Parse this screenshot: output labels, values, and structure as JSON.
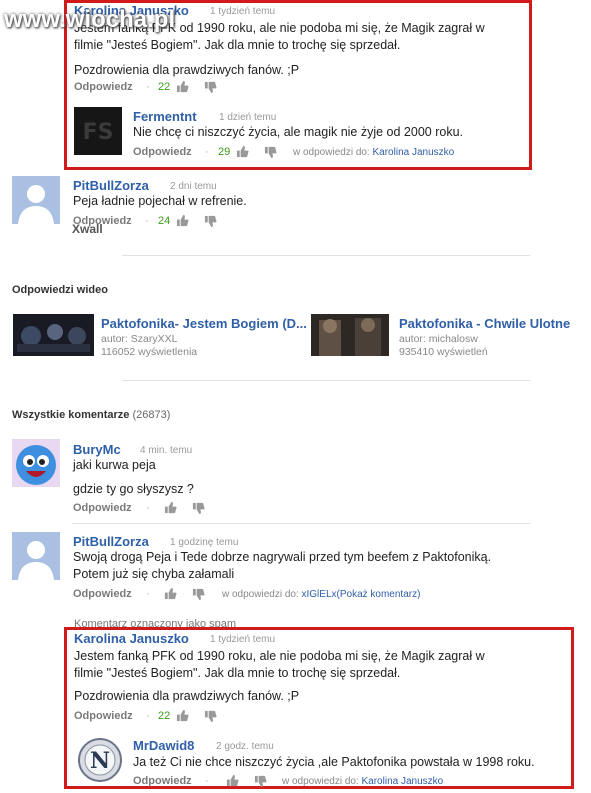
{
  "watermark": "www.wiocha.pl",
  "top_comment": {
    "author": "Karolina Januszko",
    "time": "1 tydzień temu",
    "line1": "Jestem fanką PFK od 1990 roku, ale nie podoba mi się, że Magik zagrał w",
    "line2": "filmie \"Jesteś Bogiem\". Jak dla mnie to trochę się sprzedał.",
    "line3": "Pozdrowienia dla prawdziwych fanów. ;P",
    "reply_label": "Odpowiedz",
    "likes": "22"
  },
  "top_reply": {
    "author": "Fermentnt",
    "time": "1 dzień temu",
    "text": "Nie chcę ci niszczyć życia, ale magik nie żyje od 2000 roku.",
    "reply_label": "Odpowiedz",
    "likes": "29",
    "in_reply_prefix": "w odpowiedzi do:",
    "in_reply_user": "Karolina Januszko"
  },
  "pitbull1": {
    "author": "PitBullZorza",
    "time": "2 dni temu",
    "text": "Peja ładnie pojechał w refrenie.",
    "reply_label": "Odpowiedz",
    "likes": "24",
    "overlay": "Xwall"
  },
  "video_section": {
    "title": "Odpowiedzi wideo",
    "videos": [
      {
        "title": "Paktofonika- Jestem Bogiem (D...",
        "author": "autor: SzaryXXL",
        "views": "116052 wyświetlenia"
      },
      {
        "title": "Paktofonika - Chwile Ulotne",
        "author": "autor: michalosw",
        "views": "935410 wyświetleń"
      }
    ]
  },
  "all_comments": {
    "title": "Wszystkie komentarze",
    "count": "(26873)"
  },
  "burymc": {
    "author": "BuryMc",
    "time": "4 min. temu",
    "line1": "jaki kurwa peja",
    "line2": "gdzie ty go słyszysz ?",
    "reply_label": "Odpowiedz"
  },
  "pitbull2": {
    "author": "PitBullZorza",
    "time": "1 godzinę temu",
    "line1": "Swoją drogą Peja i Tede dobrze nagrywali przed tym beefem z Paktofoniką.",
    "line2": "Potem już się chyba załamali",
    "reply_label": "Odpowiedz",
    "in_reply_prefix": "w odpowiedzi do:",
    "in_reply_user": "xIGlELx",
    "show_comment": "(Pokaż komentarz)"
  },
  "flagged": "Komentarz oznaczony jako spam",
  "bottom_comment": {
    "author": "Karolina Januszko",
    "time": "1 tydzień temu",
    "line1": "Jestem fanką PFK od 1990 roku, ale nie podoba mi się, że Magik zagrał w",
    "line2": "filmie \"Jesteś Bogiem\". Jak dla mnie to trochę się sprzedał.",
    "line3": "Pozdrowienia dla prawdziwych fanów. ;P",
    "reply_label": "Odpowiedz",
    "likes": "22"
  },
  "bottom_reply": {
    "author": "MrDawid8",
    "time": "2 godz. temu",
    "text": "Ja też Ci nie chce niszczyć życia ,ale Paktofonika powstała w 1998 roku.",
    "reply_label": "Odpowiedz",
    "in_reply_prefix": "w odpowiedzi do:",
    "in_reply_user": "Karolina Januszko"
  },
  "colors": {
    "highlight_border": "#d11a1a",
    "link_blue": "#2f5fa7",
    "like_green": "#3a9a1a"
  },
  "icons": [
    "thumb-up-icon",
    "thumb-down-icon",
    "default-avatar-icon",
    "wikipedia-globe-icon"
  ]
}
